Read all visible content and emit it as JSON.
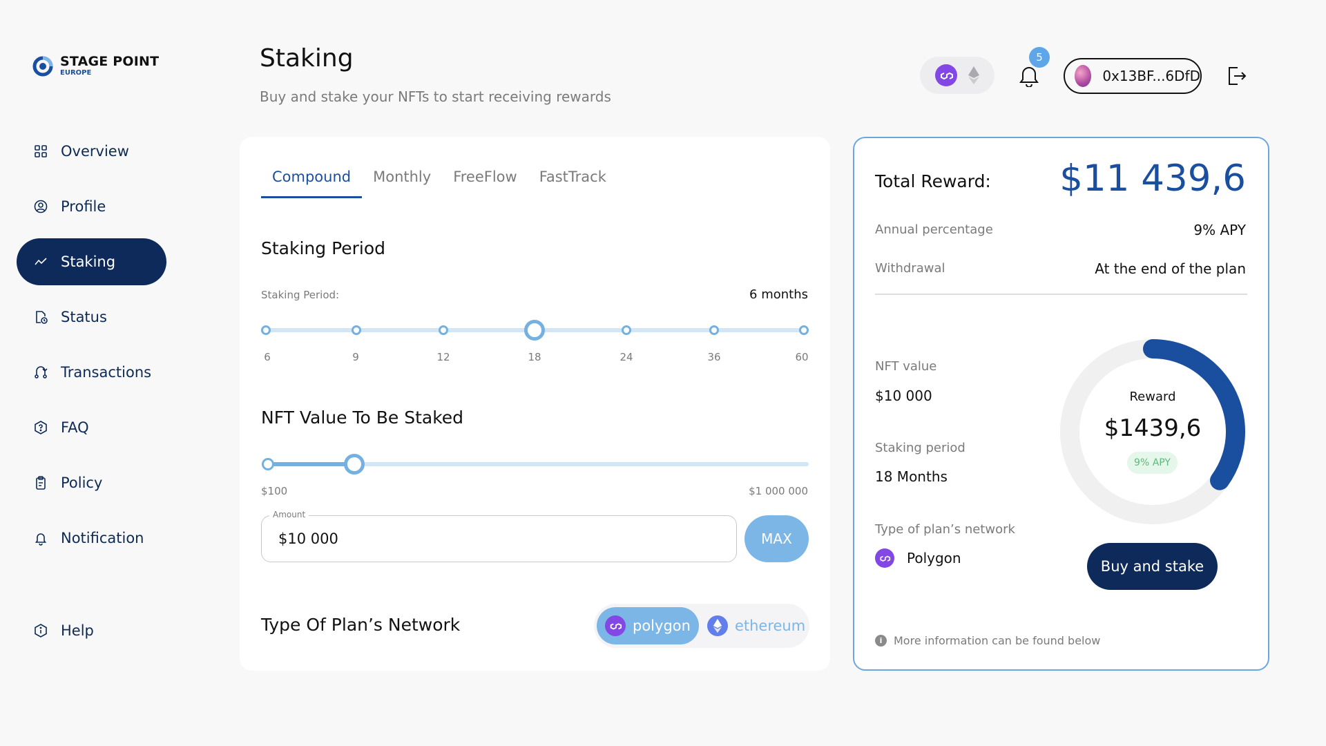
{
  "brand": {
    "name": "STAGE POINT",
    "sub": "EUROPE"
  },
  "sidebar": {
    "items": [
      {
        "label": "Overview",
        "icon": "grid-icon"
      },
      {
        "label": "Profile",
        "icon": "user-circle-icon"
      },
      {
        "label": "Staking",
        "icon": "trend-line-icon",
        "active": true
      },
      {
        "label": "Status",
        "icon": "document-clock-icon"
      },
      {
        "label": "Transactions",
        "icon": "transfer-icon"
      },
      {
        "label": "FAQ",
        "icon": "question-hexagon-icon"
      },
      {
        "label": "Policy",
        "icon": "clipboard-icon"
      },
      {
        "label": "Notification",
        "icon": "bell-icon"
      }
    ],
    "help": {
      "label": "Help",
      "icon": "info-circle-icon"
    }
  },
  "header": {
    "title": "Staking",
    "subtitle": "Buy and stake your NFTs to start receiving rewards",
    "notifications_count": "5",
    "wallet_address": "0x13BF...6DfD"
  },
  "tabs": [
    "Compound",
    "Monthly",
    "FreeFlow",
    "FastTrack"
  ],
  "staking_period": {
    "title": "Staking Period",
    "label": "Staking Period:",
    "value": "6 months",
    "ticks": [
      "6",
      "9",
      "12",
      "18",
      "24",
      "36",
      "60"
    ],
    "selected": "18"
  },
  "nft_value": {
    "title": "NFT Value To Be Staked",
    "min_label": "$100",
    "max_label": "$1 000 000",
    "slider_fraction": 0.16,
    "amount_legend": "Amount",
    "amount_value": "$10 000",
    "max_button": "MAX"
  },
  "network": {
    "title": "Type Of Plan’s Network",
    "options": [
      "polygon",
      "ethereum"
    ],
    "selected": "polygon"
  },
  "summary": {
    "total_label": "Total Reward:",
    "total_value": "$11 439,6",
    "annual_label": "Annual percentage",
    "annual_value": "9% APY",
    "withdrawal_label": "Withdrawal",
    "withdrawal_value": "At the end of the plan",
    "nft_label": "NFT value",
    "nft_value": "$10 000",
    "period_label": "Staking period",
    "period_value": "18 Months",
    "network_label": "Type of plan’s network",
    "network_value": "Polygon",
    "donut": {
      "label": "Reward",
      "value": "$1439,6",
      "badge": "9% APY",
      "fraction": 0.35
    },
    "buy_button": "Buy and stake",
    "info_text": "More information can be found below"
  },
  "colors": {
    "accent": "#1a4fa0",
    "nav_active": "#0e2a5a",
    "slider": "#74b0e0",
    "polygon": "#8247e5",
    "ethereum": "#627eea"
  }
}
